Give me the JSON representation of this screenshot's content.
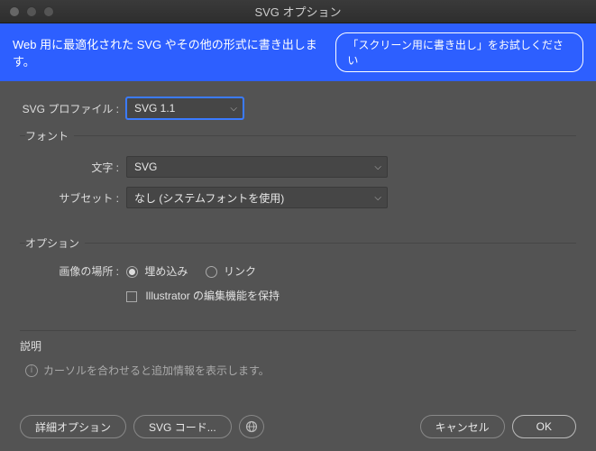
{
  "titlebar": {
    "title": "SVG オプション"
  },
  "banner": {
    "text": "Web 用に最適化された SVG やその他の形式に書き出します。",
    "button": "「スクリーン用に書き出し」をお試しください"
  },
  "profile": {
    "label": "SVG プロファイル :",
    "value": "SVG 1.1"
  },
  "font_section": {
    "legend": "フォント",
    "type_label": "文字 :",
    "type_value": "SVG",
    "subset_label": "サブセット :",
    "subset_value": "なし (システムフォントを使用)"
  },
  "options_section": {
    "legend": "オプション",
    "image_loc_label": "画像の場所 :",
    "embed": "埋め込み",
    "link": "リンク",
    "preserve": "Illustrator の編集機能を保持"
  },
  "description": {
    "legend": "説明",
    "text": "カーソルを合わせると追加情報を表示します。"
  },
  "footer": {
    "advanced": "詳細オプション",
    "svg_code": "SVG コード...",
    "cancel": "キャンセル",
    "ok": "OK"
  }
}
